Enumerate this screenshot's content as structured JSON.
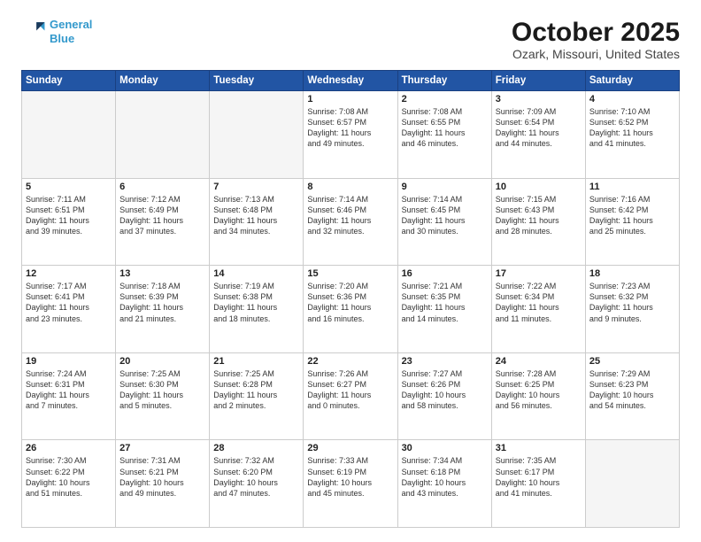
{
  "logo": {
    "line1": "General",
    "line2": "Blue"
  },
  "header": {
    "month": "October 2025",
    "location": "Ozark, Missouri, United States"
  },
  "days_of_week": [
    "Sunday",
    "Monday",
    "Tuesday",
    "Wednesday",
    "Thursday",
    "Friday",
    "Saturday"
  ],
  "weeks": [
    [
      {
        "day": "",
        "info": "",
        "empty": true
      },
      {
        "day": "",
        "info": "",
        "empty": true
      },
      {
        "day": "",
        "info": "",
        "empty": true
      },
      {
        "day": "1",
        "info": "Sunrise: 7:08 AM\nSunset: 6:57 PM\nDaylight: 11 hours\nand 49 minutes.",
        "empty": false
      },
      {
        "day": "2",
        "info": "Sunrise: 7:08 AM\nSunset: 6:55 PM\nDaylight: 11 hours\nand 46 minutes.",
        "empty": false
      },
      {
        "day": "3",
        "info": "Sunrise: 7:09 AM\nSunset: 6:54 PM\nDaylight: 11 hours\nand 44 minutes.",
        "empty": false
      },
      {
        "day": "4",
        "info": "Sunrise: 7:10 AM\nSunset: 6:52 PM\nDaylight: 11 hours\nand 41 minutes.",
        "empty": false
      }
    ],
    [
      {
        "day": "5",
        "info": "Sunrise: 7:11 AM\nSunset: 6:51 PM\nDaylight: 11 hours\nand 39 minutes.",
        "empty": false
      },
      {
        "day": "6",
        "info": "Sunrise: 7:12 AM\nSunset: 6:49 PM\nDaylight: 11 hours\nand 37 minutes.",
        "empty": false
      },
      {
        "day": "7",
        "info": "Sunrise: 7:13 AM\nSunset: 6:48 PM\nDaylight: 11 hours\nand 34 minutes.",
        "empty": false
      },
      {
        "day": "8",
        "info": "Sunrise: 7:14 AM\nSunset: 6:46 PM\nDaylight: 11 hours\nand 32 minutes.",
        "empty": false
      },
      {
        "day": "9",
        "info": "Sunrise: 7:14 AM\nSunset: 6:45 PM\nDaylight: 11 hours\nand 30 minutes.",
        "empty": false
      },
      {
        "day": "10",
        "info": "Sunrise: 7:15 AM\nSunset: 6:43 PM\nDaylight: 11 hours\nand 28 minutes.",
        "empty": false
      },
      {
        "day": "11",
        "info": "Sunrise: 7:16 AM\nSunset: 6:42 PM\nDaylight: 11 hours\nand 25 minutes.",
        "empty": false
      }
    ],
    [
      {
        "day": "12",
        "info": "Sunrise: 7:17 AM\nSunset: 6:41 PM\nDaylight: 11 hours\nand 23 minutes.",
        "empty": false
      },
      {
        "day": "13",
        "info": "Sunrise: 7:18 AM\nSunset: 6:39 PM\nDaylight: 11 hours\nand 21 minutes.",
        "empty": false
      },
      {
        "day": "14",
        "info": "Sunrise: 7:19 AM\nSunset: 6:38 PM\nDaylight: 11 hours\nand 18 minutes.",
        "empty": false
      },
      {
        "day": "15",
        "info": "Sunrise: 7:20 AM\nSunset: 6:36 PM\nDaylight: 11 hours\nand 16 minutes.",
        "empty": false
      },
      {
        "day": "16",
        "info": "Sunrise: 7:21 AM\nSunset: 6:35 PM\nDaylight: 11 hours\nand 14 minutes.",
        "empty": false
      },
      {
        "day": "17",
        "info": "Sunrise: 7:22 AM\nSunset: 6:34 PM\nDaylight: 11 hours\nand 11 minutes.",
        "empty": false
      },
      {
        "day": "18",
        "info": "Sunrise: 7:23 AM\nSunset: 6:32 PM\nDaylight: 11 hours\nand 9 minutes.",
        "empty": false
      }
    ],
    [
      {
        "day": "19",
        "info": "Sunrise: 7:24 AM\nSunset: 6:31 PM\nDaylight: 11 hours\nand 7 minutes.",
        "empty": false
      },
      {
        "day": "20",
        "info": "Sunrise: 7:25 AM\nSunset: 6:30 PM\nDaylight: 11 hours\nand 5 minutes.",
        "empty": false
      },
      {
        "day": "21",
        "info": "Sunrise: 7:25 AM\nSunset: 6:28 PM\nDaylight: 11 hours\nand 2 minutes.",
        "empty": false
      },
      {
        "day": "22",
        "info": "Sunrise: 7:26 AM\nSunset: 6:27 PM\nDaylight: 11 hours\nand 0 minutes.",
        "empty": false
      },
      {
        "day": "23",
        "info": "Sunrise: 7:27 AM\nSunset: 6:26 PM\nDaylight: 10 hours\nand 58 minutes.",
        "empty": false
      },
      {
        "day": "24",
        "info": "Sunrise: 7:28 AM\nSunset: 6:25 PM\nDaylight: 10 hours\nand 56 minutes.",
        "empty": false
      },
      {
        "day": "25",
        "info": "Sunrise: 7:29 AM\nSunset: 6:23 PM\nDaylight: 10 hours\nand 54 minutes.",
        "empty": false
      }
    ],
    [
      {
        "day": "26",
        "info": "Sunrise: 7:30 AM\nSunset: 6:22 PM\nDaylight: 10 hours\nand 51 minutes.",
        "empty": false
      },
      {
        "day": "27",
        "info": "Sunrise: 7:31 AM\nSunset: 6:21 PM\nDaylight: 10 hours\nand 49 minutes.",
        "empty": false
      },
      {
        "day": "28",
        "info": "Sunrise: 7:32 AM\nSunset: 6:20 PM\nDaylight: 10 hours\nand 47 minutes.",
        "empty": false
      },
      {
        "day": "29",
        "info": "Sunrise: 7:33 AM\nSunset: 6:19 PM\nDaylight: 10 hours\nand 45 minutes.",
        "empty": false
      },
      {
        "day": "30",
        "info": "Sunrise: 7:34 AM\nSunset: 6:18 PM\nDaylight: 10 hours\nand 43 minutes.",
        "empty": false
      },
      {
        "day": "31",
        "info": "Sunrise: 7:35 AM\nSunset: 6:17 PM\nDaylight: 10 hours\nand 41 minutes.",
        "empty": false
      },
      {
        "day": "",
        "info": "",
        "empty": true
      }
    ]
  ]
}
